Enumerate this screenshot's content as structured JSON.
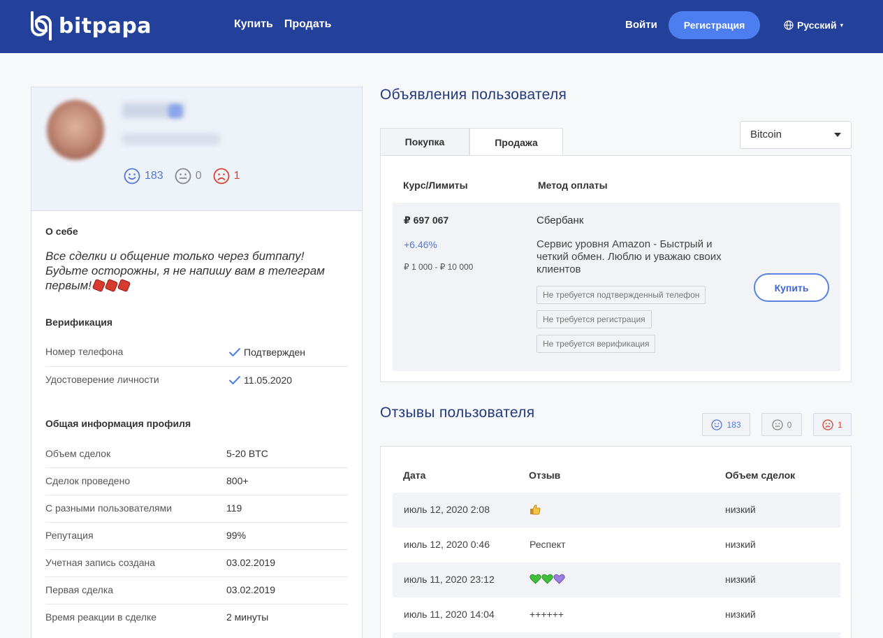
{
  "header": {
    "logo_text": "bitpapa",
    "nav": [
      "Купить",
      "Продать"
    ],
    "login": "Войти",
    "register": "Регистрация",
    "language": "Русский",
    "colors": {
      "bar": "#23409a",
      "register_button": "#4d7eef"
    }
  },
  "profile": {
    "ratings": {
      "positive": "183",
      "neutral": "0",
      "negative": "1"
    },
    "about_title": "О себе",
    "about_text": "Все сделки и общение только через битпапу! Будьте осторожны, я не напишу вам в телеграм первым!",
    "about_icons": [
      "stop-sign-icon",
      "stop-sign-icon",
      "stop-sign-icon"
    ],
    "verification_title": "Верификация",
    "verification": [
      {
        "label": "Номер телефона",
        "value": "Подтвержден"
      },
      {
        "label": "Удостоверение личности",
        "value": "11.05.2020"
      }
    ],
    "general_title": "Общая информация профиля",
    "general": [
      {
        "label": "Объем сделок",
        "value": "5-20 BTC"
      },
      {
        "label": "Сделок проведено",
        "value": "800+"
      },
      {
        "label": "С разными пользователями",
        "value": "119"
      },
      {
        "label": "Репутация",
        "value": "99%"
      },
      {
        "label": "Учетная запись создана",
        "value": "03.02.2019"
      },
      {
        "label": "Первая сделка",
        "value": "03.02.2019"
      },
      {
        "label": "Время реакции в сделке",
        "value": "2 минуты"
      }
    ]
  },
  "ads": {
    "title": "Объявления пользователя",
    "tabs": [
      "Покупка",
      "Продажа"
    ],
    "active_tab": "Продажа",
    "currency": "Bitcoin",
    "col_rate": "Курс/Лимиты",
    "col_method": "Метод оплаты",
    "item": {
      "price": "₽ 697 067",
      "percent": "+6.46%",
      "limits": "₽ 1 000 - ₽ 10 000",
      "method": "Сбербанк",
      "description": "Сервис уровня Amazon - Быстрый и четкий обмен. Люблю и уважаю своих клиентов",
      "tags": [
        "Не требуется подтвержденный телефон",
        "Не требуется регистрация",
        "Не требуется верификация"
      ],
      "buy_button": "Купить"
    }
  },
  "reviews": {
    "title": "Отзывы пользователя",
    "counts": {
      "positive": "183",
      "neutral": "0",
      "negative": "1"
    },
    "columns": [
      "Дата",
      "Отзыв",
      "Объем сделок"
    ],
    "rows": [
      {
        "date": "июль 12, 2020 2:08",
        "text": "",
        "icon": "thumbs-up-icon",
        "volume": "низкий"
      },
      {
        "date": "июль 12, 2020 0:46",
        "text": "Респект",
        "volume": "низкий"
      },
      {
        "date": "июль 11, 2020 23:12",
        "text": "",
        "icon": "hearts-icon",
        "volume": "низкий"
      },
      {
        "date": "июль 11, 2020 14:04",
        "text": "++++++",
        "volume": "низкий"
      }
    ]
  }
}
